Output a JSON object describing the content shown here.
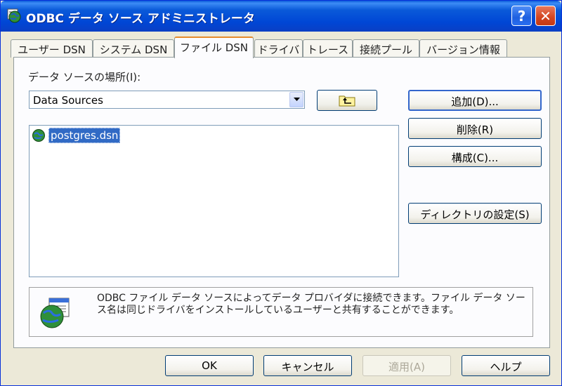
{
  "window": {
    "title": "ODBC データ ソース アドミニストレータ",
    "help_glyph": "?",
    "close_glyph": "✕"
  },
  "tabs": [
    {
      "label": "ユーザー DSN",
      "active": false
    },
    {
      "label": "システム DSN",
      "active": false
    },
    {
      "label": "ファイル DSN",
      "active": true
    },
    {
      "label": "ドライバ",
      "active": false
    },
    {
      "label": "トレース",
      "active": false
    },
    {
      "label": "接続プール",
      "active": false
    },
    {
      "label": "バージョン情報",
      "active": false
    }
  ],
  "file_dsn": {
    "location_label": "データ ソースの場所(I):",
    "location_value": "Data Sources",
    "files": [
      {
        "name": "postgres.dsn",
        "selected": true
      }
    ],
    "buttons": {
      "add": "追加(D)...",
      "delete": "削除(R)",
      "configure": "構成(C)...",
      "set_directory": "ディレクトリの設定(S)"
    },
    "info_text": "ODBC ファイル データ ソースによってデータ プロバイダに接続できます。ファイル データ ソース名は同じドライバをインストールしているユーザーと共有することができます。"
  },
  "dialog_buttons": {
    "ok": "OK",
    "cancel": "キャンセル",
    "apply": "適用(A)",
    "help": "ヘルプ"
  },
  "colors": {
    "titlebar": "#0a5ad9",
    "selection": "#316ac5",
    "active_tab_accent": "#e68b2c"
  }
}
